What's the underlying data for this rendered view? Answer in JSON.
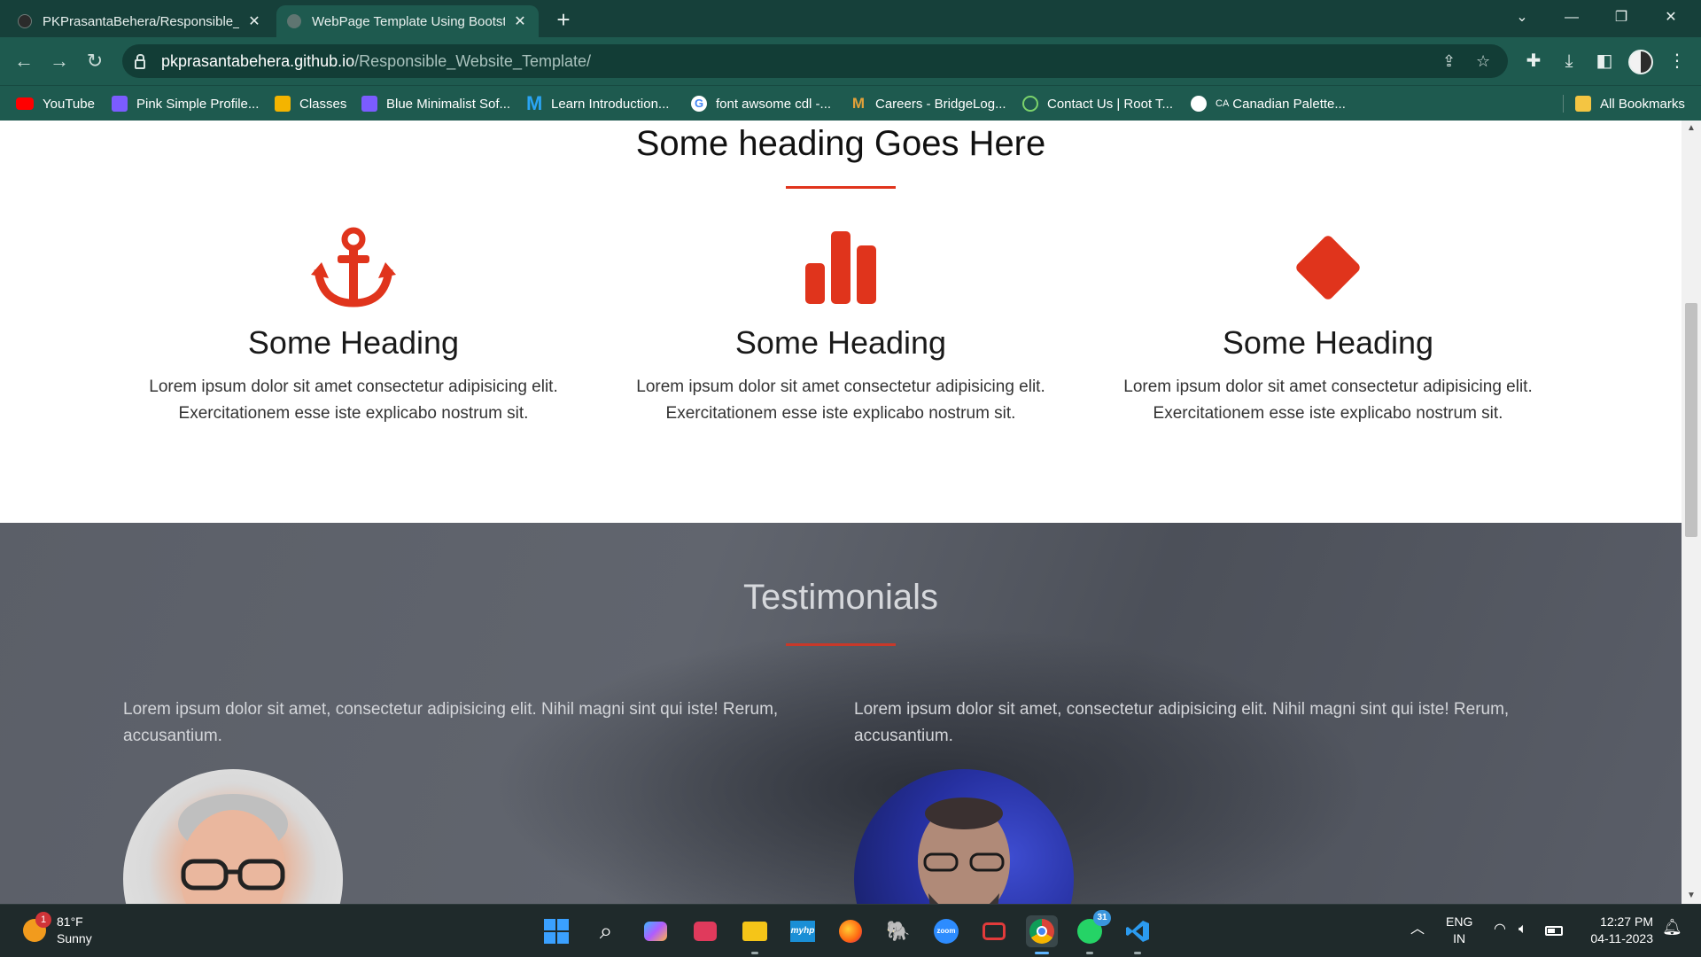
{
  "browser": {
    "tabs": [
      {
        "title": "PKPrasantaBehera/Responsible_"
      },
      {
        "title": "WebPage Template Using Bootst"
      }
    ],
    "new_tab": "+",
    "url_host": "pkprasantabehera.github.io",
    "url_path": "/Responsible_Website_Template/",
    "bookmarks": [
      {
        "label": "YouTube"
      },
      {
        "label": "Pink Simple Profile..."
      },
      {
        "label": "Classes"
      },
      {
        "label": "Blue Minimalist Sof..."
      },
      {
        "label": "Learn Introduction..."
      },
      {
        "label": "font awsome cdl -..."
      },
      {
        "label": "Careers - BridgeLog..."
      },
      {
        "label": "Contact Us | Root T..."
      },
      {
        "label": "Canadian Palette..."
      }
    ],
    "bookmarks_canadian_prefix": "CA",
    "all_bookmarks": "All Bookmarks"
  },
  "features_section": {
    "title": "Some heading Goes Here",
    "accent_color": "#e0341c",
    "items": [
      {
        "icon": "anchor-icon",
        "heading": "Some Heading",
        "text": "Lorem ipsum dolor sit amet consectetur adipisicing elit. Exercitationem esse iste explicabo nostrum sit."
      },
      {
        "icon": "bar-chart-icon",
        "heading": "Some Heading",
        "text": "Lorem ipsum dolor sit amet consectetur adipisicing elit. Exercitationem esse iste explicabo nostrum sit."
      },
      {
        "icon": "diamond-icon",
        "heading": "Some Heading",
        "text": "Lorem ipsum dolor sit amet consectetur adipisicing elit. Exercitationem esse iste explicabo nostrum sit."
      }
    ]
  },
  "testimonials": {
    "title": "Testimonials",
    "items": [
      {
        "quote": "Lorem ipsum dolor sit amet, consectetur adipisicing elit. Nihil magni sint qui iste! Rerum, accusantium."
      },
      {
        "quote": "Lorem ipsum dolor sit amet, consectetur adipisicing elit. Nihil magni sint qui iste! Rerum, accusantium."
      }
    ]
  },
  "taskbar": {
    "weather_temp": "81°F",
    "weather_desc": "Sunny",
    "weather_badge": "1",
    "whatsapp_badge": "31",
    "zoom_label": "zoom",
    "myhp_label": "myhp",
    "lang_top": "ENG",
    "lang_bottom": "IN",
    "time": "12:27 PM",
    "date": "04-11-2023"
  }
}
